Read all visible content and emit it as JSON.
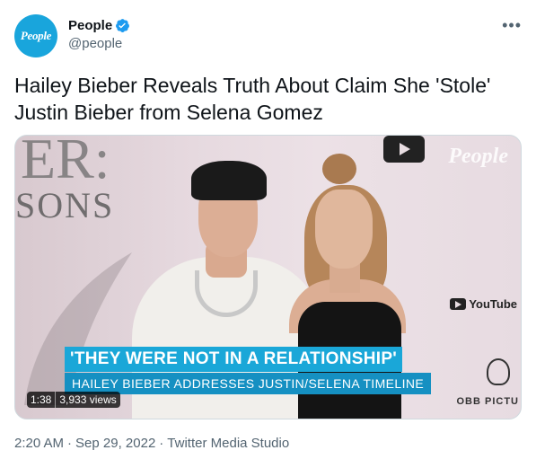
{
  "author": {
    "avatar_text": "People",
    "display_name": "People",
    "handle": "@people",
    "verified_icon": "verified-badge-icon"
  },
  "more_icon": "more-horizontal-icon",
  "tweet": {
    "text": "Hailey Bieber Reveals Truth About Claim She 'Stole' Justin Bieber from Selena Gomez"
  },
  "media": {
    "bg_letters": "ER:",
    "bg_sons": "SONS",
    "watermark": "People",
    "youtube_label": "YouTube",
    "obb_label": "OBB PICTU",
    "headline": "'THEY WERE NOT IN A RELATIONSHIP'",
    "subline": "HAILEY BIEBER ADDRESSES JUSTIN/SELENA TIMELINE",
    "duration": "1:38",
    "views": "3,933 views"
  },
  "footer": {
    "time": "2:20 AM",
    "dot1": "·",
    "date": "Sep 29, 2022",
    "dot2": "·",
    "source": "Twitter Media Studio"
  },
  "colors": {
    "accent": "#1d9bf0",
    "lower_third": "#1aa7d8"
  }
}
